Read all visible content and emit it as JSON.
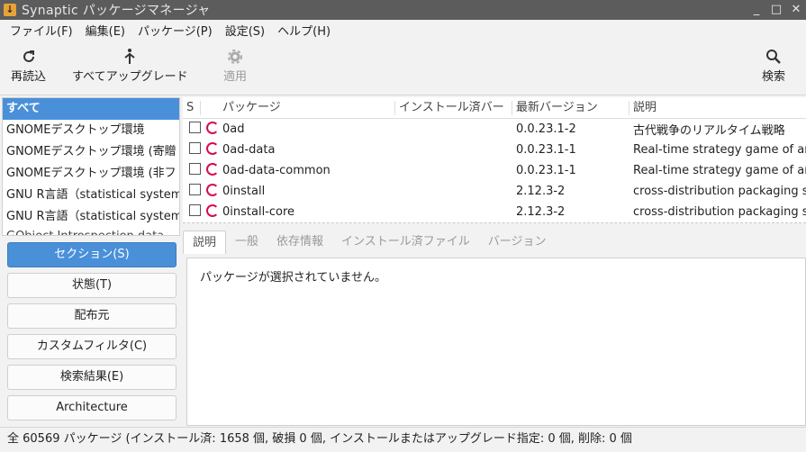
{
  "window": {
    "title": "Synaptic パッケージマネージャ",
    "minimize": "_",
    "maximize": "□",
    "close": "✕"
  },
  "menu": [
    "ファイル(F)",
    "編集(E)",
    "パッケージ(P)",
    "設定(S)",
    "ヘルプ(H)"
  ],
  "toolbar": {
    "reload": "再読込",
    "upgrade_all": "すべてアップグレード",
    "apply": "適用",
    "search": "検索"
  },
  "categories": [
    "すべて",
    "GNOMEデスクトップ環境",
    "GNOMEデスクトップ環境 (寄贈",
    "GNOMEデスクトップ環境 (非フ",
    "GNU R言語（statistical system",
    "GNU R言語（statistical system",
    "GObject Introspection data"
  ],
  "filters": [
    "セクション(S)",
    "状態(T)",
    "配布元",
    "カスタムフィルタ(C)",
    "検索結果(E)",
    "Architecture"
  ],
  "table": {
    "headers": {
      "s": "S",
      "package": "パッケージ",
      "installed": "インストール済バー",
      "latest": "最新バージョン",
      "description": "説明"
    },
    "rows": [
      {
        "name": "0ad",
        "installed": "",
        "latest": "0.0.23.1-2",
        "desc": "古代戦争のリアルタイム戦略"
      },
      {
        "name": "0ad-data",
        "installed": "",
        "latest": "0.0.23.1-1",
        "desc": "Real-time strategy game of an"
      },
      {
        "name": "0ad-data-common",
        "installed": "",
        "latest": "0.0.23.1-1",
        "desc": "Real-time strategy game of an"
      },
      {
        "name": "0install",
        "installed": "",
        "latest": "2.12.3-2",
        "desc": "cross-distribution packaging s"
      },
      {
        "name": "0install-core",
        "installed": "",
        "latest": "2.12.3-2",
        "desc": "cross-distribution packaging s"
      }
    ]
  },
  "tabs": [
    "説明",
    "一般",
    "依存情報",
    "インストール済ファイル",
    "バージョン"
  ],
  "detail": {
    "message": "パッケージが選択されていません。"
  },
  "status": "全 60569 パッケージ (インストール済: 1658 個, 破損 0 個, インストールまたはアップグレード指定: 0 個, 削除: 0 個"
}
